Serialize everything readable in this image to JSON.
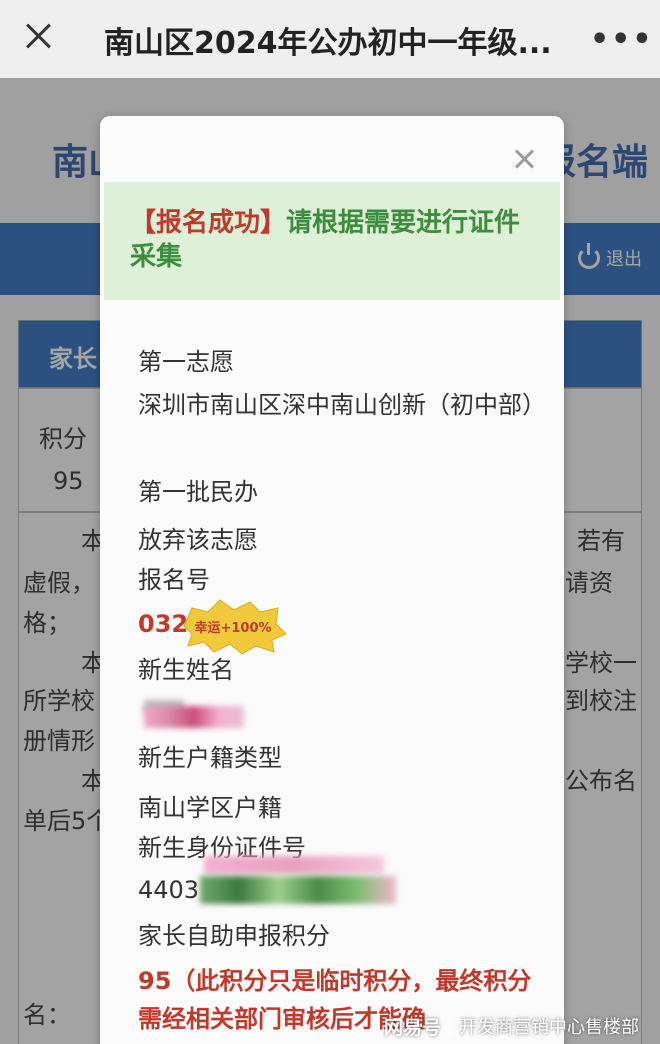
{
  "topbar": {
    "close_icon": "close-x-icon",
    "title": "南山区2024年公办初中一年级...",
    "more_icon": "more-dots-icon",
    "more_glyph": "•••"
  },
  "background": {
    "banner_left": "南山",
    "banner_right": "报名端",
    "logout_label": "退出",
    "section_label": "家长",
    "score_header": "积分",
    "score_value": "95",
    "lines": {
      "l1_left": "本",
      "l1_right": "若有",
      "l2_left": "虚假，",
      "l2_right": "请资",
      "l3_left": "格；",
      "l4_left": "本",
      "l4_right": "学校一",
      "l5_left": "所学校",
      "l5_right": "到校注",
      "l6_left": "册情形",
      "l7_left": "本",
      "l7_right": "公布名",
      "l8_left": "单后5个",
      "l9_left": "名："
    }
  },
  "modal": {
    "close_icon": "close-icon",
    "alert_tag": "【报名成功】",
    "alert_text": "请根据需要进行证件采集",
    "fields": {
      "choice_label": "第一志愿",
      "choice_value": "深圳市南山区深中南山创新（初中部）",
      "batch_value": "第一批民办",
      "give_up": "放弃该志愿",
      "regno_label": "报名号",
      "regno_value": "032",
      "sticker_text": "幸运+100%",
      "name_label": "新生姓名",
      "hukou_label": "新生户籍类型",
      "hukou_value": "南山学区户籍",
      "id_label": "新生身份证件号",
      "id_value": "4403",
      "score_label": "家长自助申报积分",
      "score_value": "95",
      "score_note": "（此积分只是临时积分，最终积分需经相关部门审核后才能确"
    }
  },
  "watermark": {
    "brand": "网易号",
    "author": "开发商营销中心售楼部"
  },
  "colors": {
    "alert_bg": "#dff0d8",
    "alert_green": "#3c8e3c",
    "alert_red": "#c0392b",
    "header_blue": "#2f6ec2"
  }
}
